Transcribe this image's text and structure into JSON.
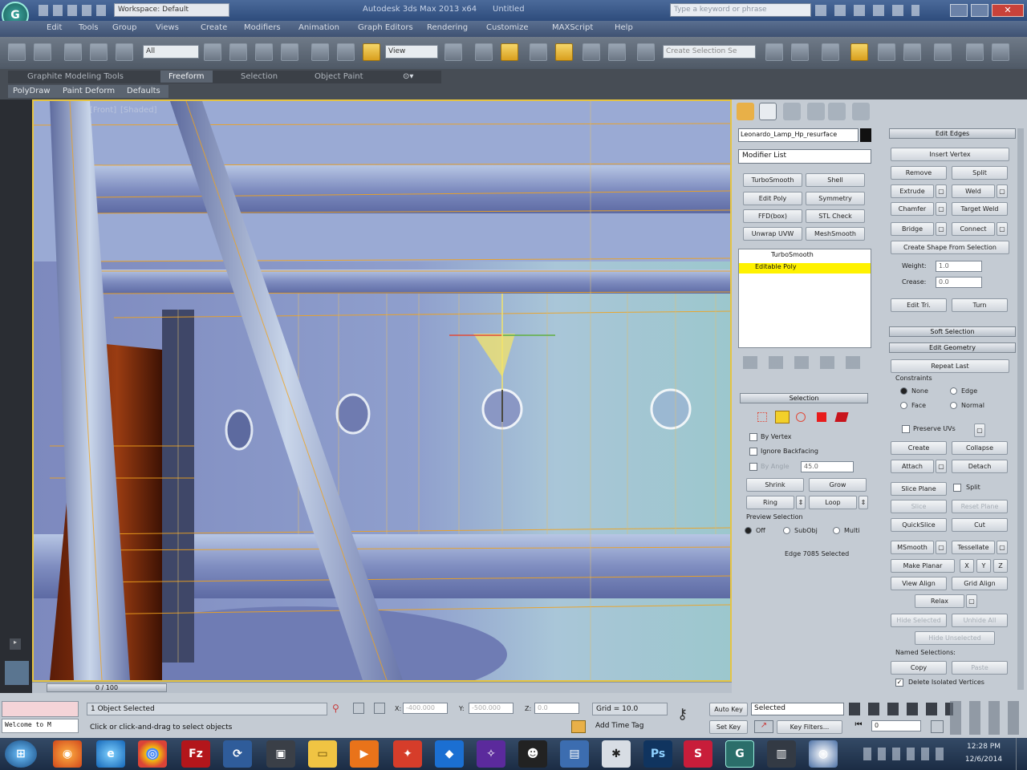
{
  "titlebar": {
    "workspace": "Workspace: Default",
    "title": "Autodesk 3ds Max 2013 x64",
    "file": "Untitled",
    "search_placeholder": "Type a keyword or phrase"
  },
  "menubar": [
    "Edit",
    "Tools",
    "Group",
    "Views",
    "Create",
    "Modifiers",
    "Animation",
    "Graph Editors",
    "Rendering",
    "Customize",
    "MAXScript",
    "Help"
  ],
  "toolbar": {
    "filter_value": "All",
    "ref_coord_value": "View",
    "named_selection_placeholder": "Create Selection Se"
  },
  "ribbon": {
    "tabs": [
      "Graphite Modeling Tools",
      "Freeform",
      "Selection",
      "Object Paint"
    ],
    "active_tab": "Freeform",
    "sub_items": [
      "PolyDraw",
      "Paint Deform",
      "Defaults"
    ]
  },
  "viewport": {
    "label_view": "[Front]",
    "label_shading": "[Shaded]"
  },
  "cmdpanel": {
    "object_name": "Leonardo_Lamp_Hp_resurface",
    "modifier_list": "Modifier List",
    "modifier_buttons": [
      "TurboSmooth",
      "Shell",
      "Edit Poly",
      "Symmetry",
      "FFD(box)",
      "STL Check",
      "Unwrap UVW",
      "MeshSmooth"
    ],
    "stack": [
      "TurboSmooth",
      "Editable Poly"
    ],
    "selection": {
      "title": "Selection",
      "by_vertex": "By Vertex",
      "ignore_backfacing": "Ignore Backfacing",
      "by_angle": "By Angle",
      "by_angle_value": "45.0",
      "shrink": "Shrink",
      "grow": "Grow",
      "ring": "Ring",
      "loop": "Loop",
      "preview_selection": "Preview Selection",
      "off": "Off",
      "subobj": "SubObj",
      "multi": "Multi",
      "status": "Edge 7085 Selected"
    },
    "edit_edges": {
      "title": "Edit Edges",
      "insert_vertex": "Insert Vertex",
      "remove": "Remove",
      "split": "Split",
      "extrude": "Extrude",
      "weld": "Weld",
      "chamfer": "Chamfer",
      "target_weld": "Target Weld",
      "bridge": "Bridge",
      "connect": "Connect",
      "create_shape": "Create Shape From Selection",
      "weight_label": "Weight:",
      "weight_value": "1.0",
      "crease_label": "Crease:",
      "crease_value": "0.0",
      "edit_tri": "Edit Tri.",
      "turn": "Turn"
    },
    "soft_selection_title": "Soft Selection",
    "edit_geometry": {
      "title": "Edit Geometry",
      "repeat_last": "Repeat Last",
      "constraints": "Constraints",
      "none": "None",
      "edge": "Edge",
      "face": "Face",
      "normal": "Normal",
      "preserve_uvs": "Preserve UVs",
      "create": "Create",
      "collapse": "Collapse",
      "attach": "Attach",
      "detach": "Detach",
      "slice_plane": "Slice Plane",
      "split": "Split",
      "slice": "Slice",
      "reset_plane": "Reset Plane",
      "quickslice": "QuickSlice",
      "cut": "Cut",
      "msmooth": "MSmooth",
      "tessellate": "Tessellate",
      "make_planar": "Make Planar",
      "x": "X",
      "y": "Y",
      "z": "Z",
      "view_align": "View Align",
      "grid_align": "Grid Align",
      "relax": "Relax",
      "hide_selected": "Hide Selected",
      "unhide_all": "Unhide All",
      "hide_unselected": "Hide Unselected",
      "named_selections": "Named Selections:",
      "copy": "Copy",
      "paste": "Paste",
      "delete_isolated": "Delete Isolated Vertices"
    }
  },
  "timeline": {
    "frame": "0 / 100"
  },
  "statusbar": {
    "listener": "Welcome to M",
    "selected": "1 Object Selected",
    "prompt": "Click or click-and-drag to select objects",
    "x_label": "X:",
    "x_value": "-400.000",
    "y_label": "Y:",
    "y_value": "-500.000",
    "z_label": "Z:",
    "z_value": "0.0",
    "grid": "Grid = 10.0",
    "add_time_tag": "Add Time Tag",
    "auto_key": "Auto Key",
    "set_key": "Set Key",
    "selected_dropdown": "Selected",
    "key_filters": "Key Filters...",
    "frame_value": "0"
  },
  "taskbar": {
    "time": "12:28 PM",
    "date": "12/6/2014"
  },
  "colors": {
    "accent_yellow": "#e6c441",
    "wire_orange": "#f0a21e",
    "viewport_blue": "#8a98c8"
  }
}
